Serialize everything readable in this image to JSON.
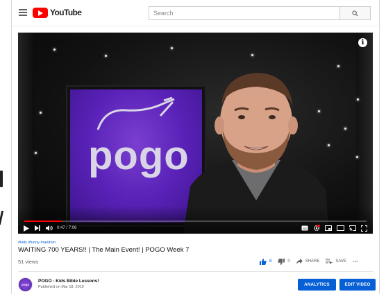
{
  "header": {
    "logo_text": "YouTube",
    "search_placeholder": "Search",
    "menu_icon": "hamburger-menu-icon",
    "search_icon": "search-icon"
  },
  "player": {
    "background_word": "pogo",
    "time_current": "0:47",
    "time_separator": " / ",
    "time_total": "7:06",
    "progress_fraction": 0.11,
    "icons": [
      "play-icon",
      "next-icon",
      "volume-icon",
      "subtitles-icon",
      "settings-icon",
      "miniplayer-icon",
      "theater-icon",
      "cast-icon",
      "fullscreen-icon",
      "info-icon"
    ]
  },
  "video": {
    "hashtags": "#kids #funny #random",
    "title": "WAITING 700 YEARS!! | The Main Event! | POGO Week 7",
    "views": "51 views",
    "likes": "8",
    "dislikes": "0",
    "share_label": "SHARE",
    "save_label": "SAVE",
    "more_label": "···"
  },
  "channel": {
    "avatar_text": "pogo",
    "name": "POGO - Kids Bible Lessons!",
    "published": "Published on Mar 18, 2019",
    "analytics_label": "ANALYTICS",
    "edit_label": "EDIT VIDEO"
  },
  "colors": {
    "accent_blue": "#065fd4",
    "youtube_red": "#ff0000",
    "pogo_purple": "#5a22b8"
  }
}
